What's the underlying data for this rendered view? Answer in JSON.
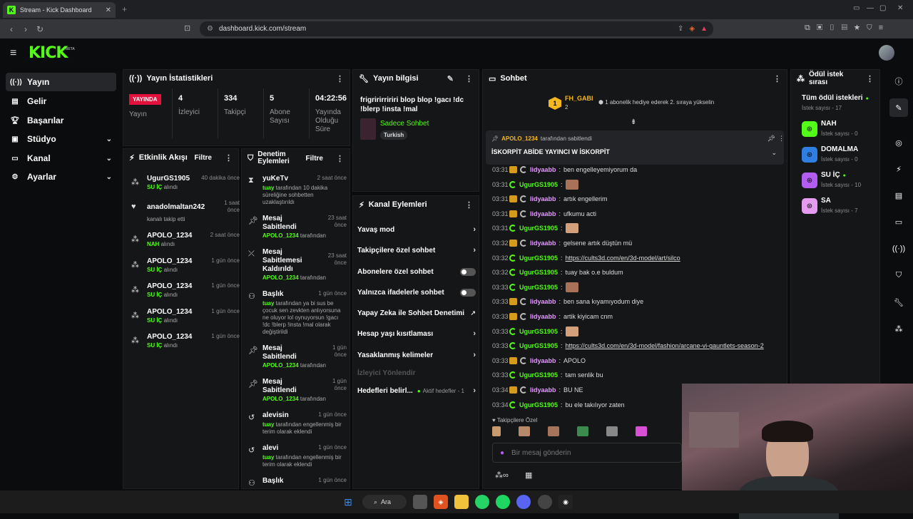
{
  "browser": {
    "tab_title": "Stream - Kick Dashboard",
    "url": "dashboard.kick.com/stream"
  },
  "brand": {
    "logo": "KICK",
    "beta": "BETA"
  },
  "sidebar": {
    "items": [
      {
        "label": "Yayın",
        "icon": "broadcast-icon"
      },
      {
        "label": "Gelir",
        "icon": "money-icon"
      },
      {
        "label": "Başarılar",
        "icon": "trophy-icon"
      },
      {
        "label": "Stüdyo",
        "icon": "studio-icon"
      },
      {
        "label": "Kanal",
        "icon": "channel-icon"
      },
      {
        "label": "Ayarlar",
        "icon": "settings-icon"
      }
    ]
  },
  "stats": {
    "title": "Yayın İstatistikleri",
    "live": "YAYINDA",
    "live_label": "Yayın",
    "items": [
      {
        "value": "4",
        "label": "İzleyici"
      },
      {
        "value": "334",
        "label": "Takipçi"
      },
      {
        "value": "5",
        "label": "Abone Sayısı"
      },
      {
        "value": "04:22:56",
        "label": "Yayında Olduğu Süre"
      }
    ]
  },
  "info": {
    "title": "Yayın bilgisi",
    "stream_title": "frigririrririri blop blop !gacı !dc !blerp !insta !mal",
    "category": "Sadece Sohbet",
    "language": "Turkish"
  },
  "activity": {
    "title": "Etkinlik Akışı",
    "filter": "Filtre",
    "items": [
      {
        "name": "UgurGS1905",
        "time": "40 dakika önce",
        "reward": "SU İÇ",
        "suffix": " alındı"
      },
      {
        "name": "anadolmaltan242",
        "time": "1 saat önce",
        "reward": "",
        "suffix": "kanalı takip etti"
      },
      {
        "name": "APOLO_1234",
        "time": "2 saat önce",
        "reward": "NAH",
        "suffix": " alındı"
      },
      {
        "name": "APOLO_1234",
        "time": "1 gün önce",
        "reward": "SU İÇ",
        "suffix": " alındı"
      },
      {
        "name": "APOLO_1234",
        "time": "1 gün önce",
        "reward": "SU İÇ",
        "suffix": " alındı"
      },
      {
        "name": "APOLO_1234",
        "time": "1 gün önce",
        "reward": "SU İÇ",
        "suffix": " alındı"
      },
      {
        "name": "APOLO_1234",
        "time": "1 gün önce",
        "reward": "SU İÇ",
        "suffix": " alındı"
      }
    ]
  },
  "modlog": {
    "title": "Denetim Eylemleri",
    "filter": "Filtre",
    "items": [
      {
        "name": "yuKeTv",
        "time": "2 saat önce",
        "user": "tuay",
        "text": " tarafından 10 dakika süreliğine sohbetten uzaklaştırıldı"
      },
      {
        "name": "Mesaj Sabitlendi",
        "time": "23 saat önce",
        "user": "APOLO_1234",
        "text": " tarafından"
      },
      {
        "name": "Mesaj Sabitlemesi Kaldırıldı",
        "time": "23 saat önce",
        "user": "APOLO_1234",
        "text": " tarafından"
      },
      {
        "name": "Başlık",
        "time": "1 gün önce",
        "user": "tuay",
        "text": " tarafından ya bi sus be çocuk sen zevkten anlıyorsuna ne oluyor lol oynuyorsun !gacı !dc !blerp !insta !mal olarak değiştirildi"
      },
      {
        "name": "Mesaj Sabitlendi",
        "time": "1 gün önce",
        "user": "APOLO_1234",
        "text": " tarafından"
      },
      {
        "name": "Mesaj Sabitlendi",
        "time": "1 gün önce",
        "user": "APOLO_1234",
        "text": " tarafından"
      },
      {
        "name": "alevisin",
        "time": "1 gün önce",
        "user": "tuay",
        "text": " tarafından engellenmiş bir terim olarak eklendi"
      },
      {
        "name": "alevi",
        "time": "1 gün önce",
        "user": "tuay",
        "text": " tarafından engellenmiş bir terim olarak eklendi"
      },
      {
        "name": "Başlık",
        "time": "1 gün önce",
        "user": "",
        "text": ""
      }
    ]
  },
  "channel_actions": {
    "title": "Kanal Eylemleri",
    "items": [
      "Yavaş mod",
      "Takipçilere özel sohbet",
      "Abonelere özel sohbet",
      "Yalnızca ifadelerle sohbet",
      "Yapay Zeka ile Sohbet Denetimi",
      "Hesap yaşı kısıtlaması",
      "Yasaklanmış kelimeler",
      "İzleyici Yönlendir"
    ],
    "goals": "Hedefleri belirl...",
    "goals_status": "Aktif hedefler - 1"
  },
  "chat": {
    "title": "Sohbet",
    "top_user": "FH_GABI",
    "top_rank": "1",
    "top_count": "2",
    "gift_note": "1 abonelik hediye ederek 2. sıraya yükselin",
    "pinned_by": "APOLO_1234",
    "pinned_suffix": " tarafından sabitlendi",
    "pinned_text": "İSKORPİT ABİDE YAYINCI W İSKORPİT",
    "messages": [
      {
        "t": "03:31",
        "u": "lidyaabb",
        "type": "c",
        "m": "ben engelleyemiyorum da"
      },
      {
        "t": "03:31",
        "u": "UgurGS1905",
        "type": "g",
        "m": "",
        "emote": 1
      },
      {
        "t": "03:31",
        "u": "lidyaabb",
        "type": "c",
        "m": "artık engellerim"
      },
      {
        "t": "03:31",
        "u": "lidyaabb",
        "type": "c",
        "m": "ufkumu acti"
      },
      {
        "t": "03:31",
        "u": "UgurGS1905",
        "type": "g",
        "m": "",
        "emote": 2
      },
      {
        "t": "03:32",
        "u": "lidyaabb",
        "type": "c",
        "m": "gelsene artık düştün mü"
      },
      {
        "t": "03:32",
        "u": "UgurGS1905",
        "type": "g",
        "m": "https://cults3d.com/en/3d-model/art/silco",
        "link": 1
      },
      {
        "t": "03:32",
        "u": "UgurGS1905",
        "type": "g",
        "m": "tuay bak o.e buldum"
      },
      {
        "t": "03:33",
        "u": "UgurGS1905",
        "type": "g",
        "m": "",
        "emote": 1
      },
      {
        "t": "03:33",
        "u": "lidyaabb",
        "type": "c",
        "m": "ben sana kıyamıyodum diye"
      },
      {
        "t": "03:33",
        "u": "lidyaabb",
        "type": "c",
        "m": "artik kiyicam cnm"
      },
      {
        "t": "03:33",
        "u": "UgurGS1905",
        "type": "g",
        "m": "",
        "emote": 2
      },
      {
        "t": "03:33",
        "u": "UgurGS1905",
        "type": "g",
        "m": "https://cults3d.com/en/3d-model/fashion/arcane-vi-gauntlets-season-2",
        "link": 1
      },
      {
        "t": "03:33",
        "u": "lidyaabb",
        "type": "c",
        "m": "APOLO"
      },
      {
        "t": "03:33",
        "u": "UgurGS1905",
        "type": "g",
        "m": "tam senlik bu"
      },
      {
        "t": "03:34",
        "u": "lidyaabb",
        "type": "c",
        "m": "BU NE"
      },
      {
        "t": "03:34",
        "u": "UgurGS1905",
        "type": "g",
        "m": "bu ele takılıyor zaten"
      }
    ],
    "followers_only": "Takipçilere Özel",
    "placeholder": "Bir mesaj gönderin"
  },
  "rewards": {
    "title": "Ödül istek sırası",
    "all": "Tüm ödül istekleri",
    "all_count": "İstek sayısı - 17",
    "items": [
      {
        "name": "NAH",
        "count": "İstek sayısı - 0",
        "color": "#53fc18"
      },
      {
        "name": "DOMALMA",
        "count": "İstek sayısı - 0",
        "color": "#2f7fe3"
      },
      {
        "name": "SU İÇ",
        "count": "İstek sayısı - 10",
        "color": "#b25cf0"
      },
      {
        "name": "SA",
        "count": "İstek sayısı - 7",
        "color": "#e59bef"
      }
    ]
  },
  "taskbar": {
    "search": "Ara"
  }
}
